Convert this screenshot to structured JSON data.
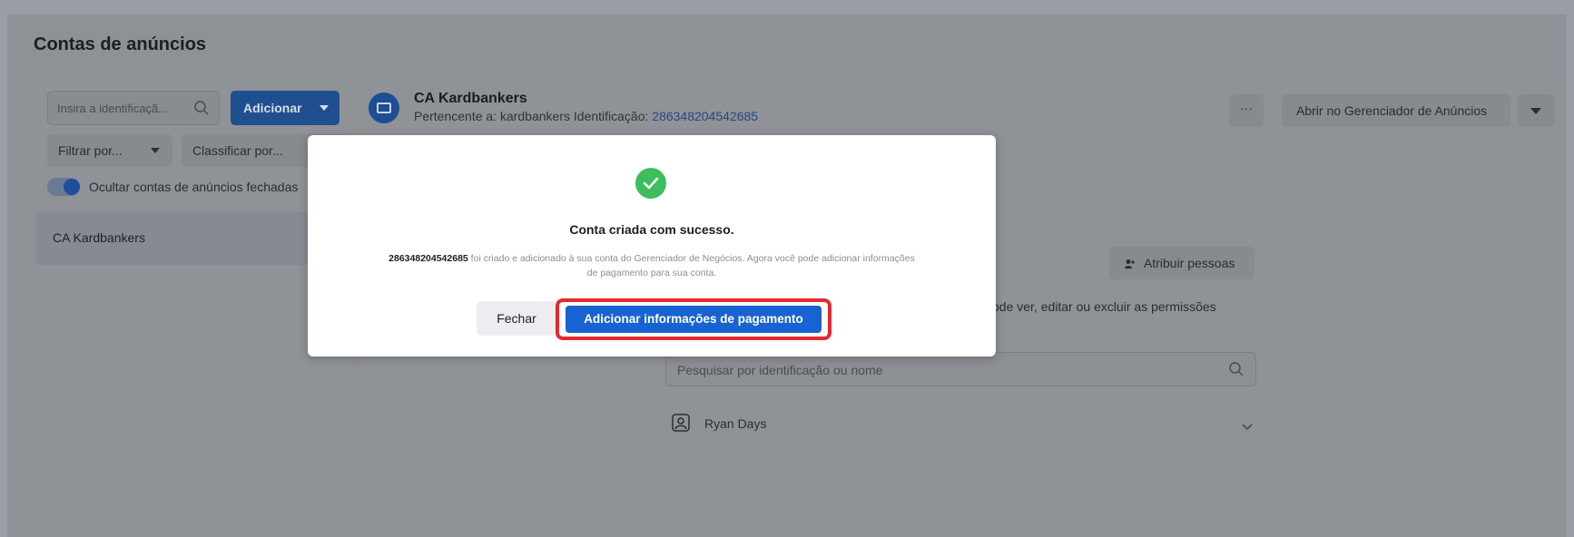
{
  "page": {
    "title": "Contas de anúncios"
  },
  "sidebar": {
    "search_placeholder": "Insira a identificaçã...",
    "add_button": "Adicionar",
    "filter_label": "Filtrar por...",
    "sort_label": "Classificar por...",
    "toggle_label": "Ocultar contas de anúncios fechadas",
    "toggle_on": true,
    "accounts": [
      {
        "name": "CA Kardbankers"
      }
    ]
  },
  "account": {
    "name": "CA Kardbankers",
    "owner_prefix": "Pertencente a: kardbankers",
    "id_prefix": "Identificação:",
    "id": "286348204542685",
    "more_label": "···",
    "open_button": "Abrir no Gerenciador de Anúncios"
  },
  "permissions": {
    "assign_button": "Atribuir pessoas",
    "text_fragment": "ode ver, editar ou excluir as permissões",
    "search_placeholder": "Pesquisar por identificação ou nome",
    "people": [
      {
        "name": "Ryan Days"
      }
    ]
  },
  "modal": {
    "title": "Conta criada com sucesso.",
    "account_id": "286348204542685",
    "message_line1": " foi criado e adicionado à sua conta do Gerenciador de Negócios. Agora você pode adicionar informações",
    "message_line2": "de pagamento para sua conta.",
    "close_button": "Fechar",
    "primary_button": "Adicionar informações de pagamento"
  },
  "colors": {
    "primary": "#1763d1",
    "success": "#3cbe5d",
    "highlight": "#e7282f",
    "overlay": "#8f9297"
  }
}
